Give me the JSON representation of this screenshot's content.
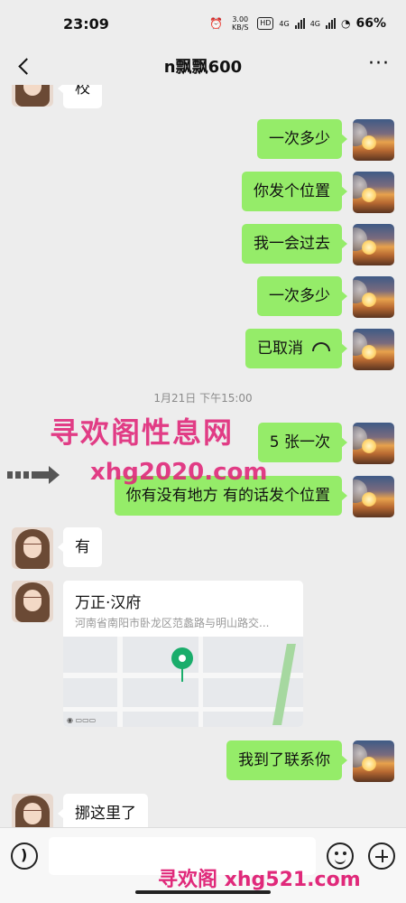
{
  "status_bar": {
    "time": "23:09",
    "net_speed": "3.00 KB/S",
    "hd_badge": "HD",
    "signal_1": "4G",
    "signal_2": "4G",
    "battery": "66%"
  },
  "header": {
    "title": "n飘飘600",
    "more_label": "···"
  },
  "messages": [
    {
      "from": "friend",
      "text": "校"
    },
    {
      "from": "me",
      "text": "一次多少"
    },
    {
      "from": "me",
      "text": "你发个位置"
    },
    {
      "from": "me",
      "text": "我一会过去"
    },
    {
      "from": "me",
      "text": "一次多少"
    },
    {
      "from": "me",
      "text": "已取消",
      "icon": "call-hangup-icon"
    },
    {
      "timestamp": "1月21日 下午15:00"
    },
    {
      "from": "me",
      "text": "5 张一次"
    },
    {
      "from": "me",
      "text": "你有没有地方  有的话发个位置"
    },
    {
      "from": "friend",
      "text": "有"
    },
    {
      "from": "friend",
      "type": "location",
      "name": "万正·汉府",
      "address": "河南省南阳市卧龙区范蠡路与明山路交..."
    },
    {
      "from": "me",
      "text": "我到了联系你"
    },
    {
      "from": "friend",
      "text": "挪这里了"
    }
  ],
  "watermarks": {
    "line1": "寻欢阁性息网",
    "line2": "xhg2020.com",
    "line3": "寻欢阁 xhg521.com",
    "color": "#e0297a"
  },
  "input_bar": {
    "placeholder": ""
  },
  "colors": {
    "my_bubble": "#95ec69",
    "friend_bubble": "#ffffff",
    "background": "#ededed"
  }
}
